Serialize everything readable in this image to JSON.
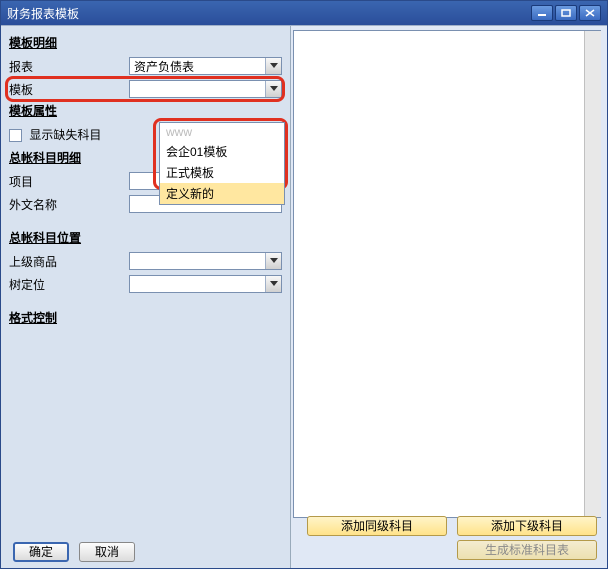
{
  "window": {
    "title": "财务报表模板"
  },
  "left": {
    "section_template_detail": "模板明细",
    "label_report": "报表",
    "value_report": "资产负债表",
    "label_template": "模板",
    "section_template_prop": "模板属性",
    "label_show_missing": "显示缺失科目",
    "section_gl_detail": "总帐科目明细",
    "label_item": "项目",
    "label_foreign": "外文名称",
    "section_gl_pos": "总帐科目位置",
    "label_parent": "上级商品",
    "label_treepos": "树定位",
    "section_format": "格式控制"
  },
  "dropdown": {
    "opt0": "www",
    "opt1": "会企01模板",
    "opt2": "正式模板",
    "opt3": "定义新的"
  },
  "buttons": {
    "add_same": "添加同级科目",
    "add_sub": "添加下级科目",
    "gen_std": "生成标准科目表",
    "ok": "确定",
    "cancel": "取消"
  }
}
